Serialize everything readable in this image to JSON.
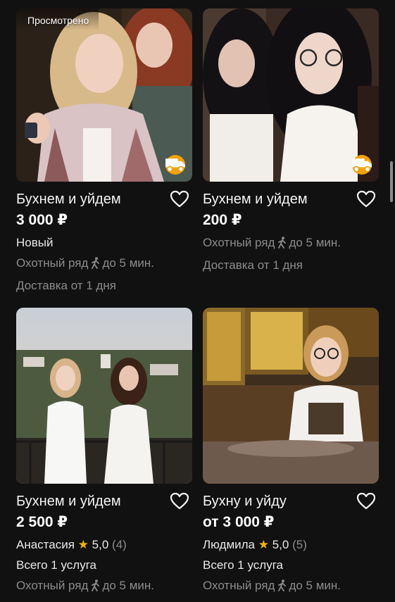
{
  "cards": [
    {
      "viewed_label": "Просмотрено",
      "title": "Бухнем и уйдем",
      "price": "3 000 ₽",
      "condition": "Новый",
      "location": "Охотный ряд",
      "walk_time": "до 5 мин.",
      "delivery": "Доставка от 1 дня",
      "has_delivery_badge": true
    },
    {
      "title": "Бухнем и уйдем",
      "price": "200 ₽",
      "location": "Охотный ряд",
      "walk_time": "до 5 мин.",
      "delivery": "Доставка от 1 дня",
      "has_delivery_badge": true
    },
    {
      "title": "Бухнем и уйдем",
      "price": "2 500 ₽",
      "seller": "Анастасия",
      "rating": "5,0",
      "rating_count": "(4)",
      "services": "Всего 1 услуга",
      "location": "Охотный ряд",
      "walk_time": "до 5 мин."
    },
    {
      "title": "Бухну и уйду",
      "price": "от 3 000 ₽",
      "seller": "Людмила",
      "rating": "5,0",
      "rating_count": "(5)",
      "services": "Всего 1 услуга",
      "location": "Охотный ряд",
      "walk_time": "до 5 мин."
    }
  ],
  "icons": {
    "favorite": "heart-outline-icon",
    "delivery": "delivery-truck-icon",
    "walk": "walking-person-icon",
    "rating": "star-icon"
  },
  "colors": {
    "background": "#111111",
    "delivery_badge": "#f2a20a",
    "star": "#f5b400",
    "muted_text": "#8c8c8c"
  }
}
